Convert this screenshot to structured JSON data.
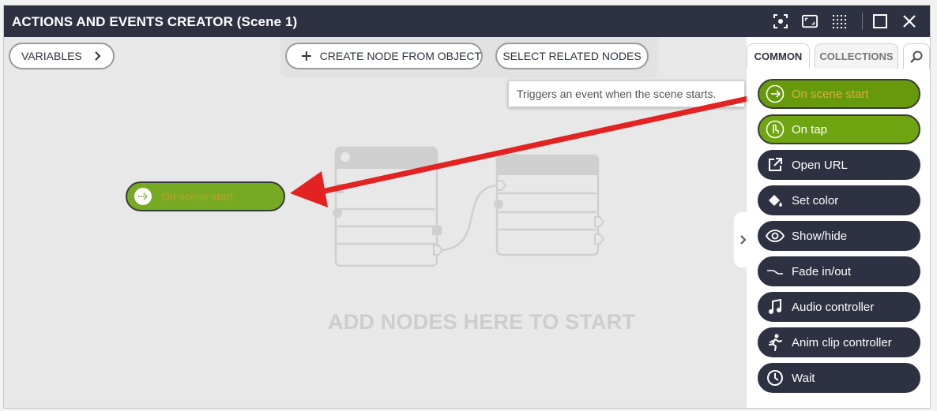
{
  "window": {
    "title": "ACTIONS AND EVENTS CREATOR (Scene 1)"
  },
  "toolbar": {
    "variables_label": "VARIABLES",
    "create_node_label": "CREATE NODE FROM OBJECT",
    "select_related_label": "SELECT RELATED NODES"
  },
  "canvas": {
    "empty_hint": "ADD NODES HERE TO START",
    "dragged_node_label": "On scene start"
  },
  "tooltip": {
    "text": "Triggers an event when the scene starts."
  },
  "sidebar": {
    "tabs": [
      "COMMON",
      "COLLECTIONS"
    ],
    "items": [
      {
        "label": "On scene start",
        "icon": "enter-icon"
      },
      {
        "label": "On tap",
        "icon": "tap-icon"
      },
      {
        "label": "Open URL",
        "icon": "external-link-icon"
      },
      {
        "label": "Set color",
        "icon": "paint-bucket-icon"
      },
      {
        "label": "Show/hide",
        "icon": "eye-icon"
      },
      {
        "label": "Fade in/out",
        "icon": "fade-curve-icon"
      },
      {
        "label": "Audio controller",
        "icon": "music-note-icon"
      },
      {
        "label": "Anim clip controller",
        "icon": "running-figure-icon"
      },
      {
        "label": "Wait",
        "icon": "clock-icon"
      }
    ]
  },
  "colors": {
    "titlebar": "#2e3141",
    "event_green": "#6ea510",
    "arrow_red": "#e32222"
  }
}
